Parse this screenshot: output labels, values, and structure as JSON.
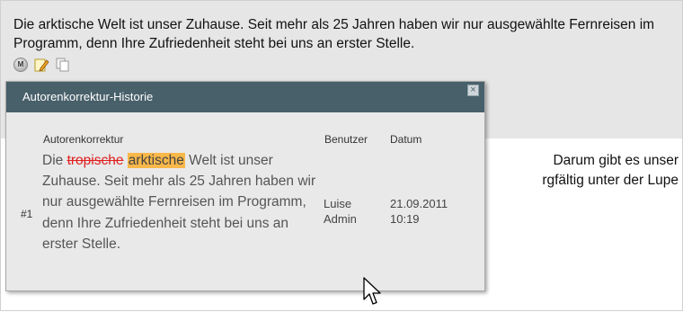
{
  "segment": {
    "text": "Die arktische Welt ist unser Zuhause. Seit mehr als 25 Jahren haben wir nur ausgewählte Fernreisen im Programm, denn Ihre Zufriedenheit steht bei uns an erster Stelle.",
    "icon_m_label": "M"
  },
  "next_segment": {
    "line1": "Darum gibt es unser",
    "line2": "rgfältig unter der Lupe"
  },
  "popup": {
    "title": "Autorenkorrektur-Historie",
    "close_label": "×",
    "columns": {
      "correction": "Autorenkorrektur",
      "user": "Benutzer",
      "date": "Datum"
    },
    "rows": [
      {
        "number": "#1",
        "prefix": "Die ",
        "deleted": "tropische",
        "inserted": "arktische",
        "rest": " Welt ist unser Zuhause. Seit mehr als 25 Jahren haben wir nur ausgewählte Fernreisen im Programm, denn Ihre Zufriedenheit steht bei uns an erster Stelle.",
        "user_line1": "Luise",
        "user_line2": "Admin",
        "date_line1": "21.09.2011",
        "date_line2": "10:19"
      }
    ]
  },
  "colors": {
    "title_bar": "#48606a",
    "deleted_text": "#e02020",
    "inserted_highlight": "#f8b84a"
  },
  "icons": [
    "m-badge-icon",
    "edit-pencil-icon",
    "copy-icon",
    "close-icon",
    "mouse-cursor-icon"
  ]
}
